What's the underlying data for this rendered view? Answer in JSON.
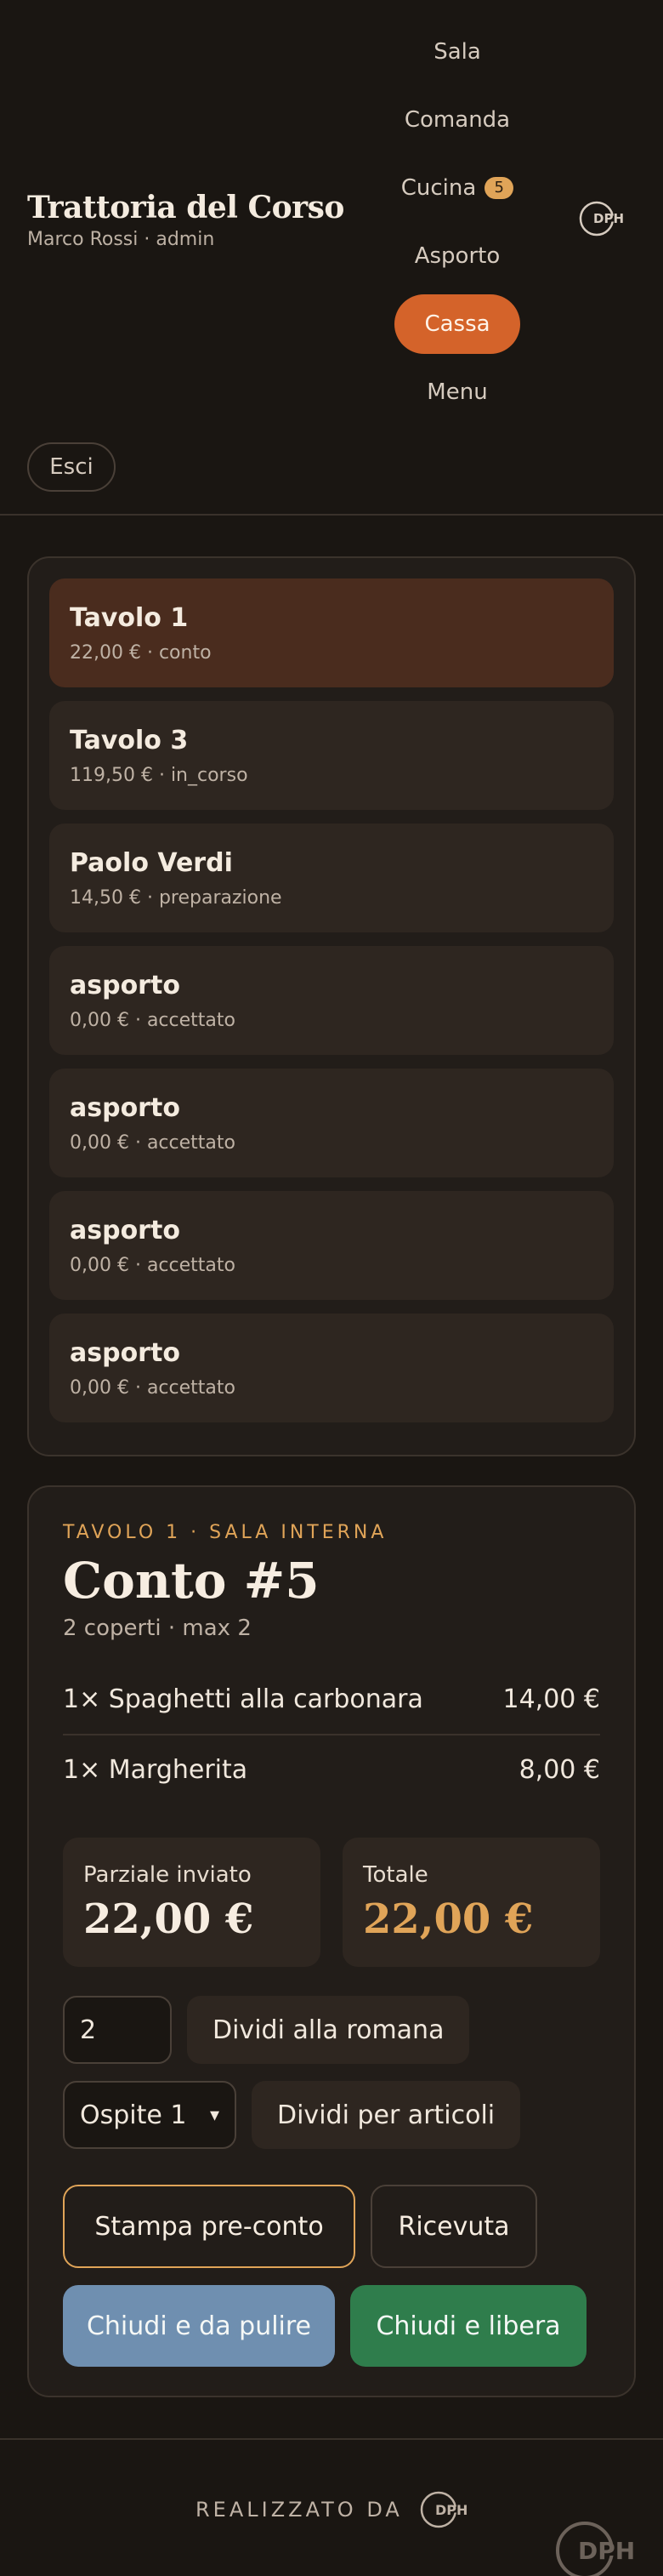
{
  "header": {
    "title": "Trattoria del Corso",
    "subtitle": "Marco Rossi · admin",
    "nav": [
      {
        "label": "Sala"
      },
      {
        "label": "Comanda"
      },
      {
        "label": "Cucina",
        "badge": "5"
      },
      {
        "label": "Asporto"
      },
      {
        "label": "Cassa",
        "active": true
      },
      {
        "label": "Menu"
      }
    ],
    "exit_label": "Esci",
    "logo_text": "DPH"
  },
  "orders": [
    {
      "name": "Tavolo 1",
      "meta": "22,00 € · conto",
      "selected": true
    },
    {
      "name": "Tavolo 3",
      "meta": "119,50 € · in_corso"
    },
    {
      "name": "Paolo Verdi",
      "meta": "14,50 € · preparazione"
    },
    {
      "name": "asporto",
      "meta": "0,00 € · accettato"
    },
    {
      "name": "asporto",
      "meta": "0,00 € · accettato"
    },
    {
      "name": "asporto",
      "meta": "0,00 € · accettato"
    },
    {
      "name": "asporto",
      "meta": "0,00 € · accettato"
    }
  ],
  "bill": {
    "eyebrow": "TAVOLO 1 · SALA INTERNA",
    "title": "Conto #5",
    "subtitle": "2 coperti · max 2",
    "items": [
      {
        "label": "1× Spaghetti alla carbonara",
        "price": "14,00 €"
      },
      {
        "label": "1× Margherita",
        "price": "8,00 €"
      }
    ],
    "partial_label": "Parziale inviato",
    "partial_value": "22,00 €",
    "total_label": "Totale",
    "total_value": "22,00 €",
    "split_count": "2",
    "split_roman_label": "Dividi alla romana",
    "guest_select": "Ospite 1",
    "split_items_label": "Dividi per articoli",
    "preconto_label": "Stampa pre-conto",
    "receipt_label": "Ricevuta",
    "close_clean_label": "Chiudi e da pulire",
    "close_free_label": "Chiudi e libera"
  },
  "footer": {
    "credit": "REALIZZATO DA",
    "logo_text": "DPH"
  },
  "colors": {
    "background": "#1a1612",
    "accent": "#d4632a",
    "gold": "#e0a458",
    "blue_button": "#6f8fb0",
    "green_button": "#2f7d4c"
  }
}
